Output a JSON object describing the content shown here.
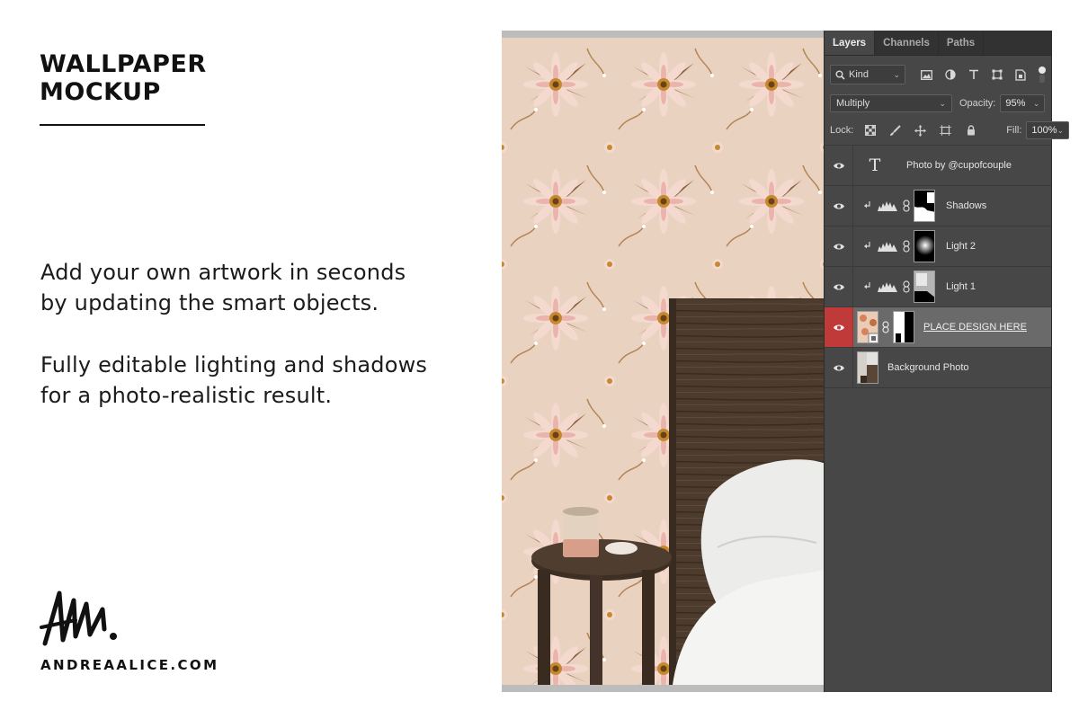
{
  "left": {
    "title_line1": "WALLPAPER",
    "title_line2": "MOCKUP",
    "desc1_line1": "Add your own artwork in seconds",
    "desc1_line2": "by updating the smart objects.",
    "desc2_line1": "Fully editable lighting and shadows",
    "desc2_line2": "for a photo-realistic result.",
    "website": "ANDREAALICE.COM"
  },
  "panel": {
    "tabs": [
      {
        "label": "Layers",
        "active": true
      },
      {
        "label": "Channels",
        "active": false
      },
      {
        "label": "Paths",
        "active": false
      }
    ],
    "filter_kind": "Kind",
    "blend_mode": "Multiply",
    "opacity_label": "Opacity:",
    "opacity_value": "95%",
    "lock_label": "Lock:",
    "fill_label": "Fill:",
    "fill_value": "100%",
    "layers": [
      {
        "name": "Photo by @cupofcouple",
        "type": "text"
      },
      {
        "name": "Shadows",
        "type": "adjustment"
      },
      {
        "name": "Light 2",
        "type": "adjustment"
      },
      {
        "name": "Light 1",
        "type": "adjustment"
      },
      {
        "name": "PLACE DESIGN HERE",
        "type": "smart-object",
        "selected": true
      },
      {
        "name": "Background Photo",
        "type": "image"
      }
    ],
    "colors": {
      "panel_bg": "#474747",
      "selected_row": "#6a6a6a",
      "selected_eye": "#c13a3a"
    }
  }
}
